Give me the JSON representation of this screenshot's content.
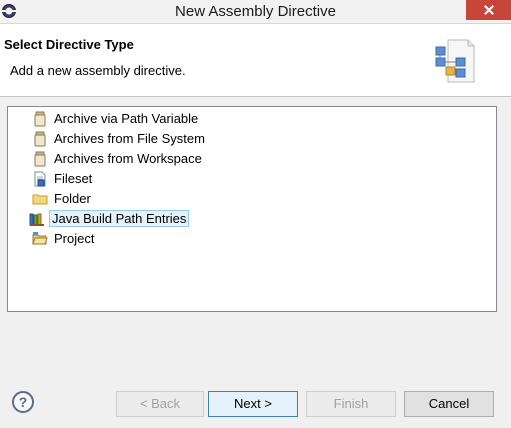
{
  "window": {
    "title": "New Assembly Directive"
  },
  "header": {
    "title": "Select Directive Type",
    "description": "Add a new assembly directive."
  },
  "tree": {
    "items": [
      {
        "label": "Archive via Path Variable",
        "icon": "jar-icon"
      },
      {
        "label": "Archives from File System",
        "icon": "jar-icon"
      },
      {
        "label": "Archives from Workspace",
        "icon": "jar-icon"
      },
      {
        "label": "Fileset",
        "icon": "fileset-icon"
      },
      {
        "label": "Folder",
        "icon": "folder-icon"
      },
      {
        "label": "Java Build Path Entries",
        "icon": "library-icon",
        "selected": true
      },
      {
        "label": "Project",
        "icon": "project-folder-icon"
      }
    ]
  },
  "buttons": {
    "back": "< Back",
    "next": "Next >",
    "finish": "Finish",
    "cancel": "Cancel",
    "help": "?"
  },
  "colors": {
    "close_button": "#c7463a",
    "selection_fill": "#e5f1fb",
    "selection_border": "#99c9ef"
  }
}
